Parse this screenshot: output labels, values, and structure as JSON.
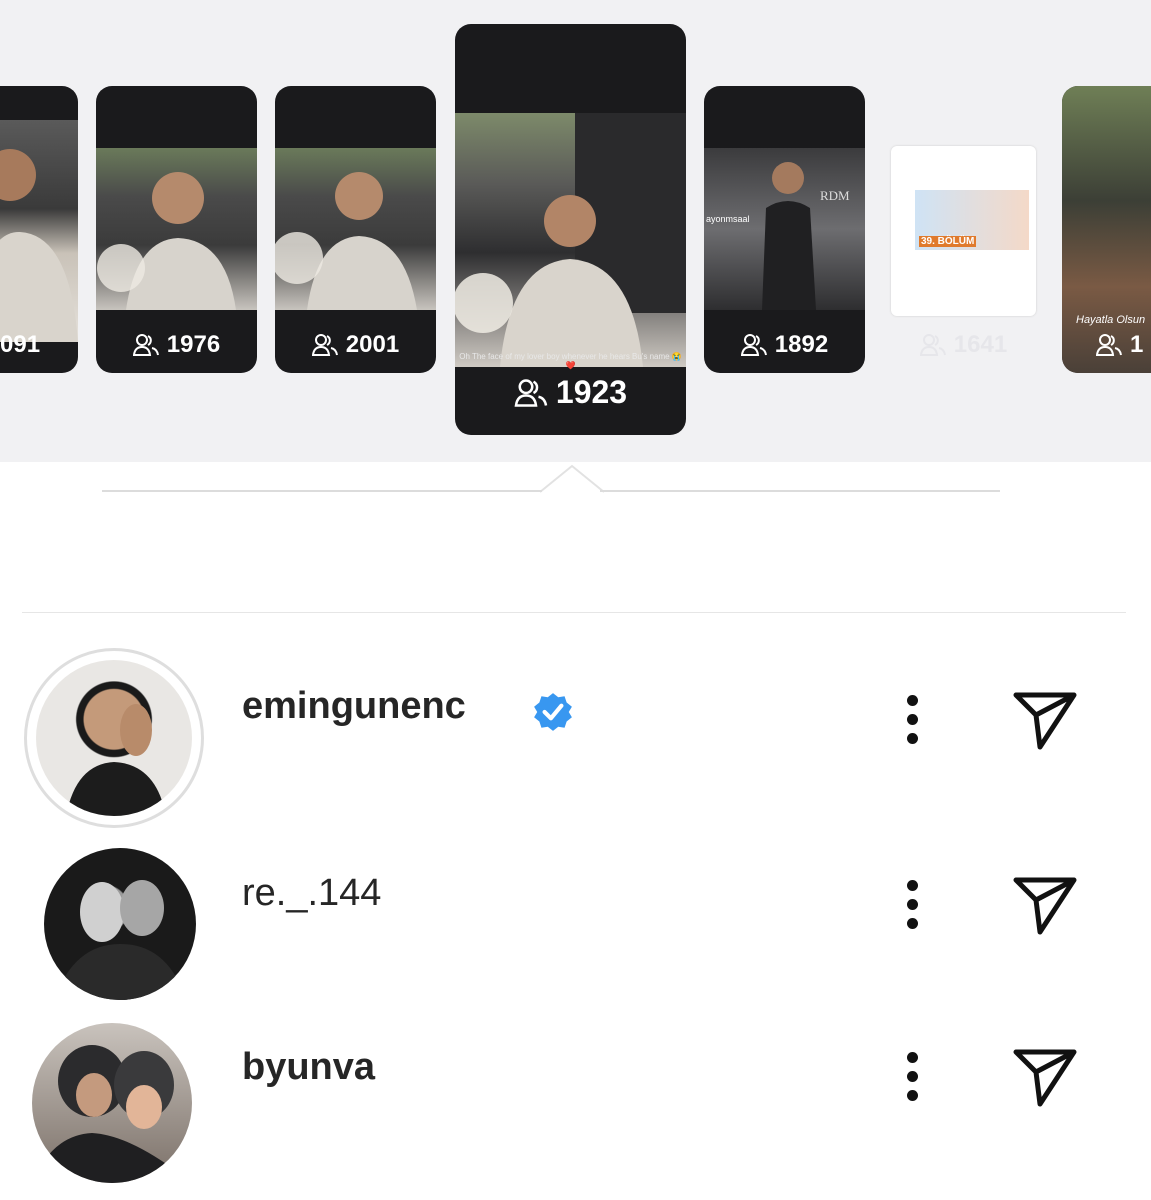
{
  "stories": [
    {
      "viewers": "091",
      "active": false
    },
    {
      "viewers": "1976",
      "active": false
    },
    {
      "viewers": "2001",
      "active": false
    },
    {
      "viewers": "1923",
      "active": true,
      "caption": "Oh The face of my lover boy whenever he hears Bu's name 😭❤️"
    },
    {
      "viewers": "1892",
      "active": false,
      "overlay": "ayonmsaal",
      "overlay2": "RDM"
    },
    {
      "viewers": "1641",
      "active": false,
      "overlay": "39. BÖLÜM"
    },
    {
      "viewers": "1",
      "active": false,
      "overlay": "Hayatla Olsun"
    }
  ],
  "viewers_list": [
    {
      "username": "emingunenc",
      "verified": true
    },
    {
      "username": "re._.144",
      "verified": false
    },
    {
      "username": "byunva",
      "verified": false
    }
  ],
  "colors": {
    "verified": "#3897f0",
    "card": "#1a1a1c",
    "strip": "#f1f1f3"
  },
  "icons": {
    "viewers": "people-icon",
    "more": "more-vertical-icon",
    "send": "paper-plane-icon",
    "verified": "verified-badge-icon"
  }
}
